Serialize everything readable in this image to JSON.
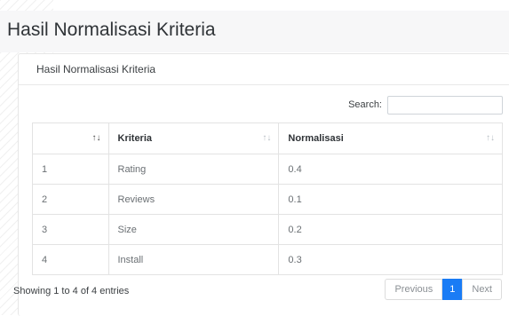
{
  "page": {
    "title": "Hasil Normalisasi Kriteria"
  },
  "card": {
    "title": "Hasil Normalisasi Kriteria"
  },
  "search": {
    "label": "Search:",
    "value": ""
  },
  "table": {
    "headers": [
      "",
      "Kriteria",
      "Normalisasi"
    ],
    "rows": [
      [
        "1",
        "Rating",
        "0.4"
      ],
      [
        "2",
        "Reviews",
        "0.1"
      ],
      [
        "3",
        "Size",
        "0.2"
      ],
      [
        "4",
        "Install",
        "0.3"
      ]
    ]
  },
  "footer": {
    "info": "Showing 1 to 4 of 4 entries"
  },
  "pagination": {
    "previous": "Previous",
    "current": "1",
    "next": "Next"
  },
  "colors": {
    "accent": "#1a7cf5",
    "title_bar": "#f7f7f8"
  }
}
